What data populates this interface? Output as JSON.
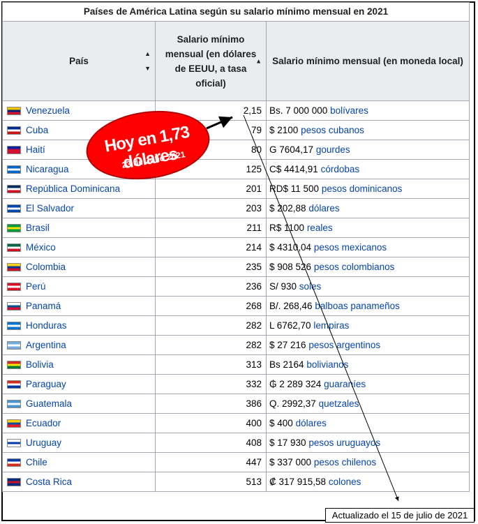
{
  "table": {
    "caption": "Países de América Latina según su salario mínimo mensual en 2021",
    "headers": {
      "country": "País",
      "usd": "Salario mínimo mensual (en dólares de EEUU, a tasa oficial)",
      "local": "Salario mínimo mensual (en moneda local)"
    },
    "rows": [
      {
        "country": "Venezuela",
        "usd": "2,15",
        "local_prefix": "Bs. 7 000 000",
        "local_currency": "bolívares",
        "flag": [
          "#f4c400",
          "#00247d",
          "#cf142b"
        ]
      },
      {
        "country": "Cuba",
        "usd": "79",
        "local_prefix": "$ 2100",
        "local_currency": "pesos cubanos",
        "flag": [
          "#002a8f",
          "#ffffff",
          "#cb1515"
        ]
      },
      {
        "country": "Haití",
        "usd": "80",
        "local_prefix": "G 7604,17",
        "local_currency": "gourdes",
        "flag": [
          "#00209f",
          "#d21034",
          "#d21034"
        ]
      },
      {
        "country": "Nicaragua",
        "usd": "125",
        "local_prefix": "C$ 4414,91",
        "local_currency": "córdobas",
        "flag": [
          "#0067c6",
          "#ffffff",
          "#0067c6"
        ]
      },
      {
        "country": "República Dominicana",
        "usd": "201",
        "local_prefix": "RD$ 11 500",
        "local_currency": "pesos dominicanos",
        "flag": [
          "#002d62",
          "#ffffff",
          "#ce1126"
        ]
      },
      {
        "country": "El Salvador",
        "usd": "203",
        "local_prefix": "$ 202,88",
        "local_currency": "dólares",
        "flag": [
          "#0047ab",
          "#ffffff",
          "#0047ab"
        ]
      },
      {
        "country": "Brasil",
        "usd": "211",
        "local_prefix": "R$ 1100",
        "local_currency": "reales",
        "flag": [
          "#009c3b",
          "#ffdf00",
          "#009c3b"
        ]
      },
      {
        "country": "México",
        "usd": "214",
        "local_prefix": "$ 4310,04",
        "local_currency": "pesos mexicanos",
        "flag": [
          "#006847",
          "#ffffff",
          "#ce1126"
        ]
      },
      {
        "country": "Colombia",
        "usd": "235",
        "local_prefix": "$ 908 526",
        "local_currency": "pesos colombianos",
        "flag": [
          "#fcd116",
          "#003893",
          "#ce1126"
        ]
      },
      {
        "country": "Perú",
        "usd": "236",
        "local_prefix": "S/ 930",
        "local_currency": "soles",
        "flag": [
          "#d91023",
          "#ffffff",
          "#d91023"
        ]
      },
      {
        "country": "Panamá",
        "usd": "268",
        "local_prefix": "B/. 268,46",
        "local_currency": "balboas panameños",
        "flag": [
          "#ffffff",
          "#005293",
          "#d21034"
        ]
      },
      {
        "country": "Honduras",
        "usd": "282",
        "local_prefix": "L 6762,70",
        "local_currency": "lempiras",
        "flag": [
          "#0073cf",
          "#ffffff",
          "#0073cf"
        ]
      },
      {
        "country": "Argentina",
        "usd": "282",
        "local_prefix": "$ 27 216",
        "local_currency": "pesos argentinos",
        "flag": [
          "#74acdf",
          "#ffffff",
          "#74acdf"
        ]
      },
      {
        "country": "Bolivia",
        "usd": "313",
        "local_prefix": "Bs 2164",
        "local_currency": "bolivianos",
        "flag": [
          "#d52b1e",
          "#f9e300",
          "#007934"
        ]
      },
      {
        "country": "Paraguay",
        "usd": "332",
        "local_prefix": "₲ 2 289 324",
        "local_currency": "guaraníes",
        "flag": [
          "#d52b1e",
          "#ffffff",
          "#0038a8"
        ]
      },
      {
        "country": "Guatemala",
        "usd": "386",
        "local_prefix": "Q. 2992,37",
        "local_currency": "quetzales",
        "flag": [
          "#4997d0",
          "#ffffff",
          "#4997d0"
        ]
      },
      {
        "country": "Ecuador",
        "usd": "400",
        "local_prefix": "$ 400",
        "local_currency": "dólares",
        "flag": [
          "#ffd100",
          "#034ea2",
          "#ed1c24"
        ]
      },
      {
        "country": "Uruguay",
        "usd": "408",
        "local_prefix": "$ 17 930",
        "local_currency": "pesos uruguayos",
        "flag": [
          "#ffffff",
          "#0038a8",
          "#ffffff"
        ]
      },
      {
        "country": "Chile",
        "usd": "447",
        "local_prefix": "$ 337 000",
        "local_currency": "pesos chilenos",
        "flag": [
          "#0039a6",
          "#ffffff",
          "#d52b1e"
        ]
      },
      {
        "country": "Costa Rica",
        "usd": "513",
        "local_prefix": "₡ 317 915,58",
        "local_currency": "colones",
        "flag": [
          "#002b7f",
          "#ce1126",
          "#002b7f"
        ]
      }
    ]
  },
  "annotation": {
    "main": "Hoy en 1,73 dólares",
    "sub": "23 de Julio 2021",
    "color": "#ff0000"
  },
  "footer": {
    "updated": "Actualizado el 15 de julio de 2021"
  }
}
